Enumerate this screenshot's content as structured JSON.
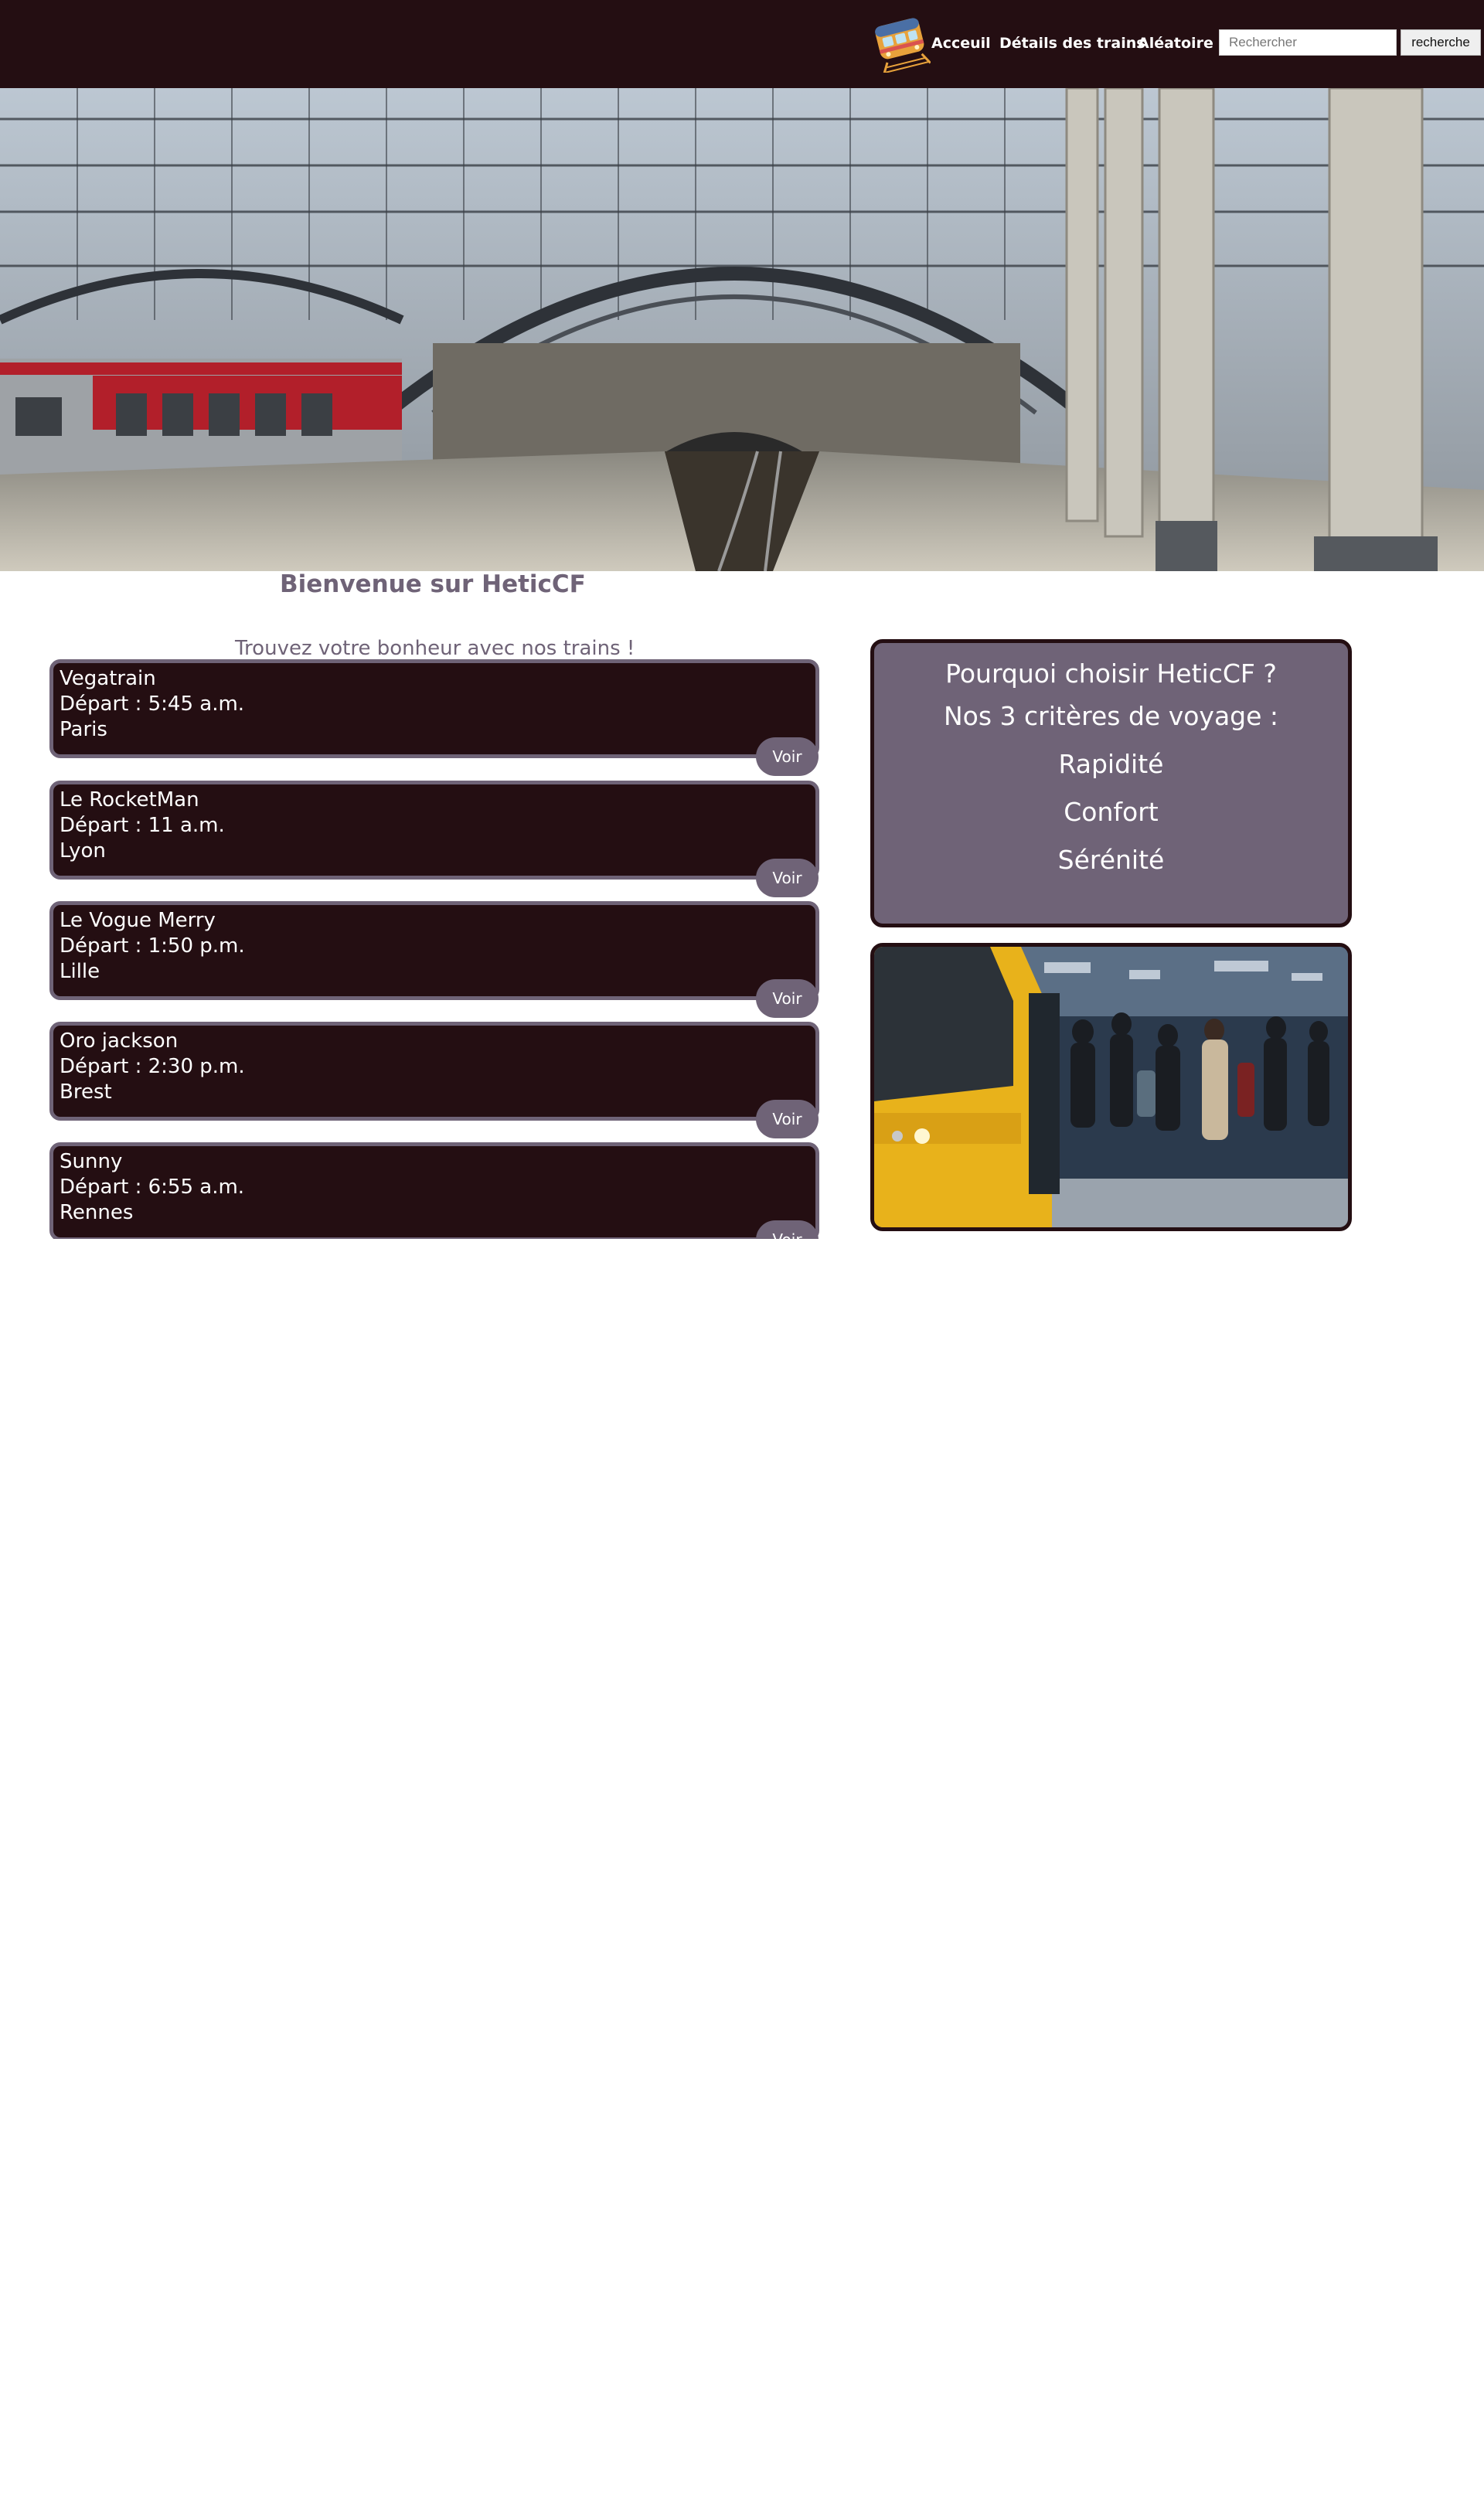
{
  "nav": {
    "links": [
      "Acceuil",
      "Détails des trains",
      "Aléatoire"
    ],
    "search_placeholder": "Rechercher",
    "search_button": "recherche",
    "logo_icon": "train-logo-icon"
  },
  "colors": {
    "dark": "#240e12",
    "accent": "#6f6377",
    "white": "#ffffff"
  },
  "main": {
    "welcome": "Bienvenue sur HeticCF",
    "tagline": "Trouvez votre bonheur avec nos trains !"
  },
  "trains": [
    {
      "name": "Vegatrain",
      "depart": "Départ : 5:45 a.m.",
      "city": "Paris",
      "button": "Voir"
    },
    {
      "name": "Le RocketMan",
      "depart": "Départ : 11 a.m.",
      "city": "Lyon",
      "button": "Voir"
    },
    {
      "name": "Le Vogue Merry",
      "depart": "Départ : 1:50 p.m.",
      "city": "Lille",
      "button": "Voir"
    },
    {
      "name": "Oro jackson",
      "depart": "Départ : 2:30 p.m.",
      "city": "Brest",
      "button": "Voir"
    },
    {
      "name": "Sunny",
      "depart": "Départ : 6:55 a.m.",
      "city": "Rennes",
      "button": "Voir"
    }
  ],
  "info": {
    "title": "Pourquoi choisir HeticCF ?",
    "subtitle": "Nos 3 critères de voyage :",
    "criteria": [
      "Rapidité",
      "Confort",
      "Sérénité"
    ]
  }
}
